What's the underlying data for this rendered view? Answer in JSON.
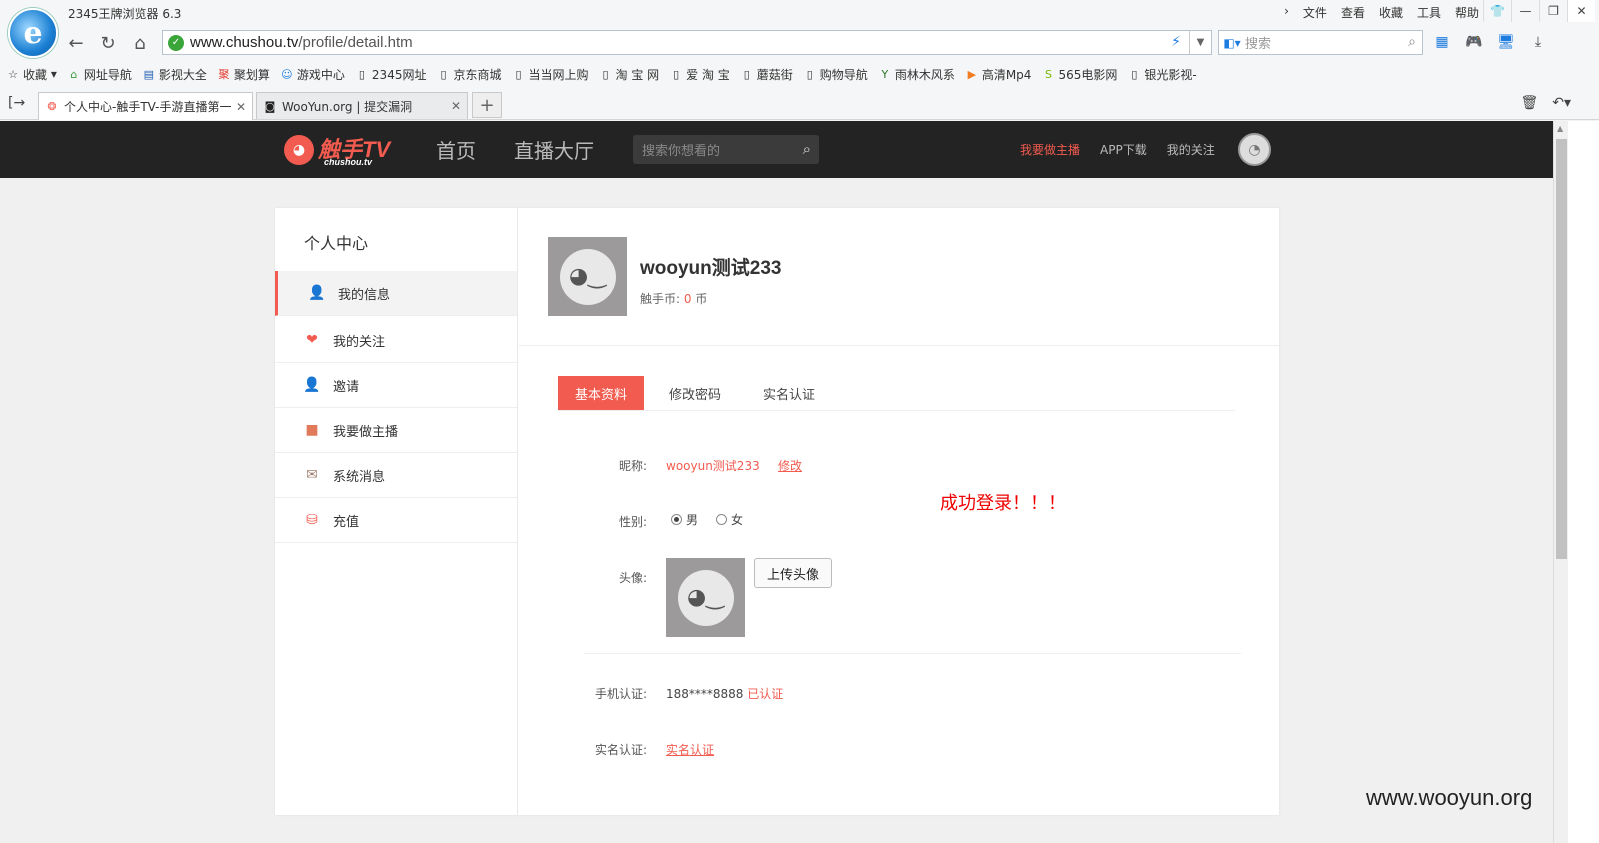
{
  "browser": {
    "title": "2345王牌浏览器 6.3",
    "menu": [
      "文件",
      "查看",
      "收藏",
      "工具",
      "帮助"
    ],
    "url_domain": "www.chushou.tv",
    "url_path": "/profile/detail.htm",
    "search_placeholder": "搜索",
    "favorites_label": "收藏",
    "favorites": [
      "网址导航",
      "影视大全",
      "聚划算",
      "游戏中心",
      "2345网址",
      "京东商城",
      "当当网上购",
      "淘 宝 网",
      "爱 淘 宝",
      "蘑菇街",
      "购物导航",
      "雨林木风系",
      "高清Mp4",
      "565电影网",
      "银光影视-"
    ],
    "tabs": [
      {
        "label": "个人中心-触手TV-手游直播第一"
      },
      {
        "label": "WooYun.org | 提交漏洞"
      }
    ]
  },
  "site": {
    "brand": "触手TV",
    "brand_sub": "chushou.tv",
    "nav": [
      "首页",
      "直播大厅"
    ],
    "search_placeholder": "搜索你想看的",
    "links": {
      "anchor": "我要做主播",
      "app": "APP下载",
      "follow": "我的关注"
    }
  },
  "sidebar": {
    "heading": "个人中心",
    "items": [
      {
        "label": "我的信息",
        "icon": "user-icon"
      },
      {
        "label": "我的关注",
        "icon": "heart-icon"
      },
      {
        "label": "邀请",
        "icon": "invite-icon"
      },
      {
        "label": "我要做主播",
        "icon": "camera-icon"
      },
      {
        "label": "系统消息",
        "icon": "mail-icon"
      },
      {
        "label": "充值",
        "icon": "coins-icon"
      }
    ]
  },
  "profile": {
    "name": "wooyun测试233",
    "coins_label": "触手币:",
    "coins_value": "0",
    "coins_unit": "币"
  },
  "tabs": [
    "基本资料",
    "修改密码",
    "实名认证"
  ],
  "form": {
    "nick_label": "昵称:",
    "nick_value": "wooyun测试233",
    "modify": "修改",
    "gender_label": "性别:",
    "gender_male": "男",
    "gender_female": "女",
    "avatar_label": "头像:",
    "upload": "上传头像",
    "phone_label": "手机认证:",
    "phone_value": "188****8888",
    "phone_status": "已认证",
    "realname_label": "实名认证:",
    "realname_link": "实名认证"
  },
  "overlay": {
    "success": "成功登录！！！",
    "watermark": "www.wooyun.org"
  },
  "colors": {
    "accent": "#f25b4f",
    "header": "#232323"
  }
}
